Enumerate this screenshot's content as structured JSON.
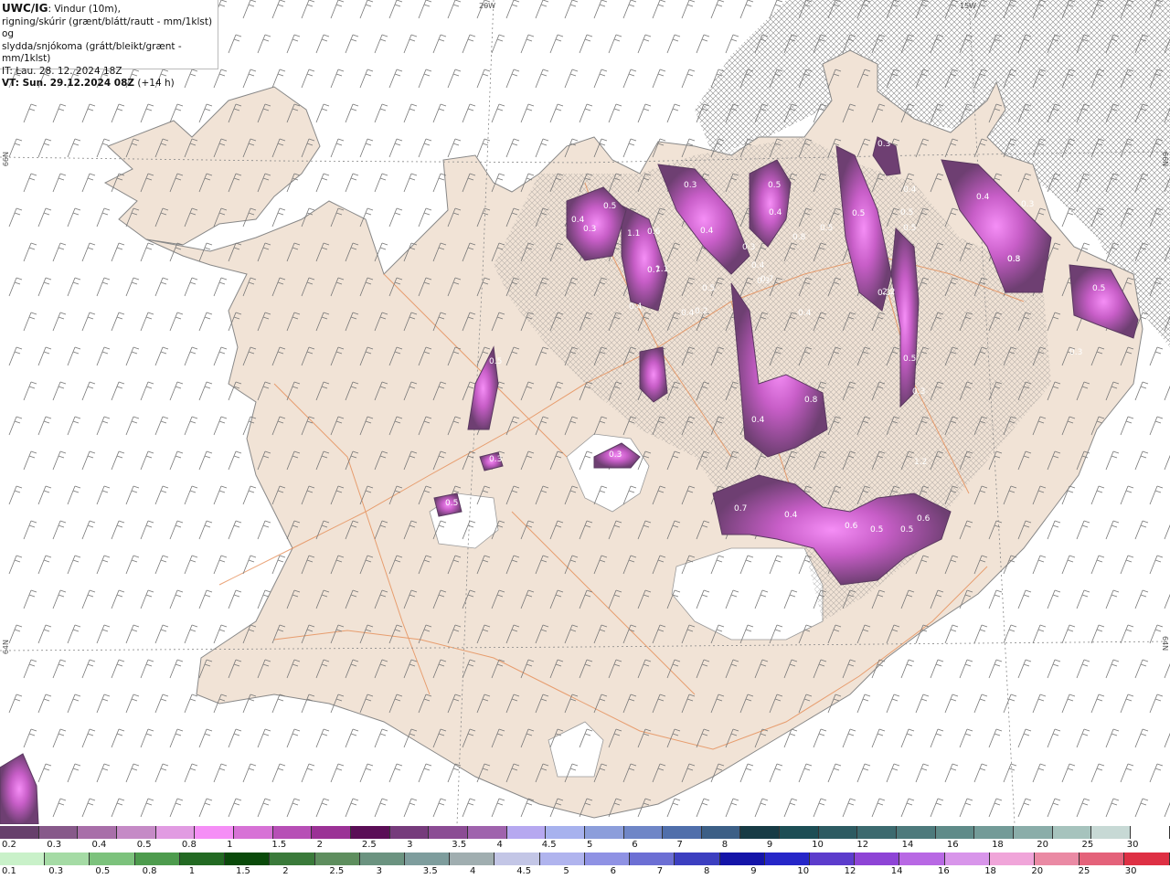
{
  "header": {
    "title": "UWC/IG",
    "line1_rest": ": Vindur (10m),",
    "line2": "rigning/skúrir (grænt/blátt/rautt - mm/1klst) og",
    "line3": "slydda/snjókoma (grátt/bleikt/grænt - mm/1klst)",
    "it": "IT: Lau. 28. 12. 2024 18Z",
    "vt_bold": "VT: Sun. 29.12.2024 08Z",
    "vt_rest": " (+14 h)"
  },
  "grid_labels": {
    "lon_20": "20W",
    "lon_15": "15W",
    "lat_66_left": "66N",
    "lat_66_right": "66N",
    "lat_64_left": "64N",
    "lat_64_right": "64N"
  },
  "precip_values": [
    "0.3",
    "0.5",
    "0.4",
    "0.4",
    "0.5",
    "1.1",
    "0.6",
    "0.3",
    "0.7",
    "0.4",
    "0.5",
    "0.4",
    "1.1",
    "0.5",
    "0.3",
    "0.5",
    "0.5",
    "0.8",
    "0.4",
    "0.3",
    "0.4",
    "0.3",
    "0.8",
    "0.5",
    "0.3",
    "0.3",
    "0.5",
    "0.2",
    "2.2",
    "1.2",
    "0.3",
    "0.4",
    "0.4",
    "0.7",
    "0.8",
    "0.4",
    "0.4",
    "0.5",
    "0.3",
    "0.5",
    "0.3",
    "0.7",
    "0.4",
    "0.6",
    "0.5",
    "0.5",
    "0.6",
    "0.3",
    "0.5",
    "0.3"
  ],
  "legend": {
    "snow_colors": [
      "#67406c",
      "#87598a",
      "#a86fa9",
      "#c58ac6",
      "#e19be2",
      "#f58ef6",
      "#d772d6",
      "#b74fb6",
      "#9b3296",
      "#5a0e56",
      "#763b7c",
      "#8b4c94",
      "#9f63ad",
      "#b6a8f0",
      "#a7b2ee",
      "#8c9edb",
      "#6f86c7",
      "#506fab",
      "#3c5f86",
      "#173b45",
      "#1d4e55",
      "#2d5b62",
      "#3c6a6f",
      "#4d7a7c",
      "#5f8b89",
      "#739b98",
      "#8aada9",
      "#a6c3bd",
      "#c7d9d5",
      "#ffffff"
    ],
    "snow_labels": [
      "0.2",
      "0.3",
      "0.4",
      "0.5",
      "0.8",
      "1",
      "1.5",
      "2",
      "2.5",
      "3",
      "3.5",
      "4",
      "4.5",
      "5",
      "6",
      "7",
      "8",
      "9",
      "10",
      "12",
      "14",
      "16",
      "18",
      "20",
      "25",
      "30"
    ],
    "rain_colors": [
      "#c9f1c9",
      "#a5dba5",
      "#7cc27c",
      "#4d9b4d",
      "#236a23",
      "#0a4a0a",
      "#3a7a3a",
      "#5e8e5e",
      "#6b9380",
      "#7e9d9d",
      "#a0aeb0",
      "#c3c6e6",
      "#b0b4ee",
      "#8f92e4",
      "#6c6fd4",
      "#3c3fc0",
      "#1414a8",
      "#2626c8",
      "#5c3ccc",
      "#8e44d6",
      "#b868e4",
      "#d895ea",
      "#f0a5d9",
      "#ea8aa4",
      "#e4627a",
      "#de3044"
    ],
    "rain_labels": [
      "0.1",
      "0.3",
      "0.5",
      "0.8",
      "1",
      "1.5",
      "2",
      "2.5",
      "3",
      "3.5",
      "4",
      "4.5",
      "5",
      "6",
      "7",
      "8",
      "9",
      "10",
      "12",
      "14",
      "16",
      "18",
      "20",
      "25",
      "30"
    ]
  }
}
